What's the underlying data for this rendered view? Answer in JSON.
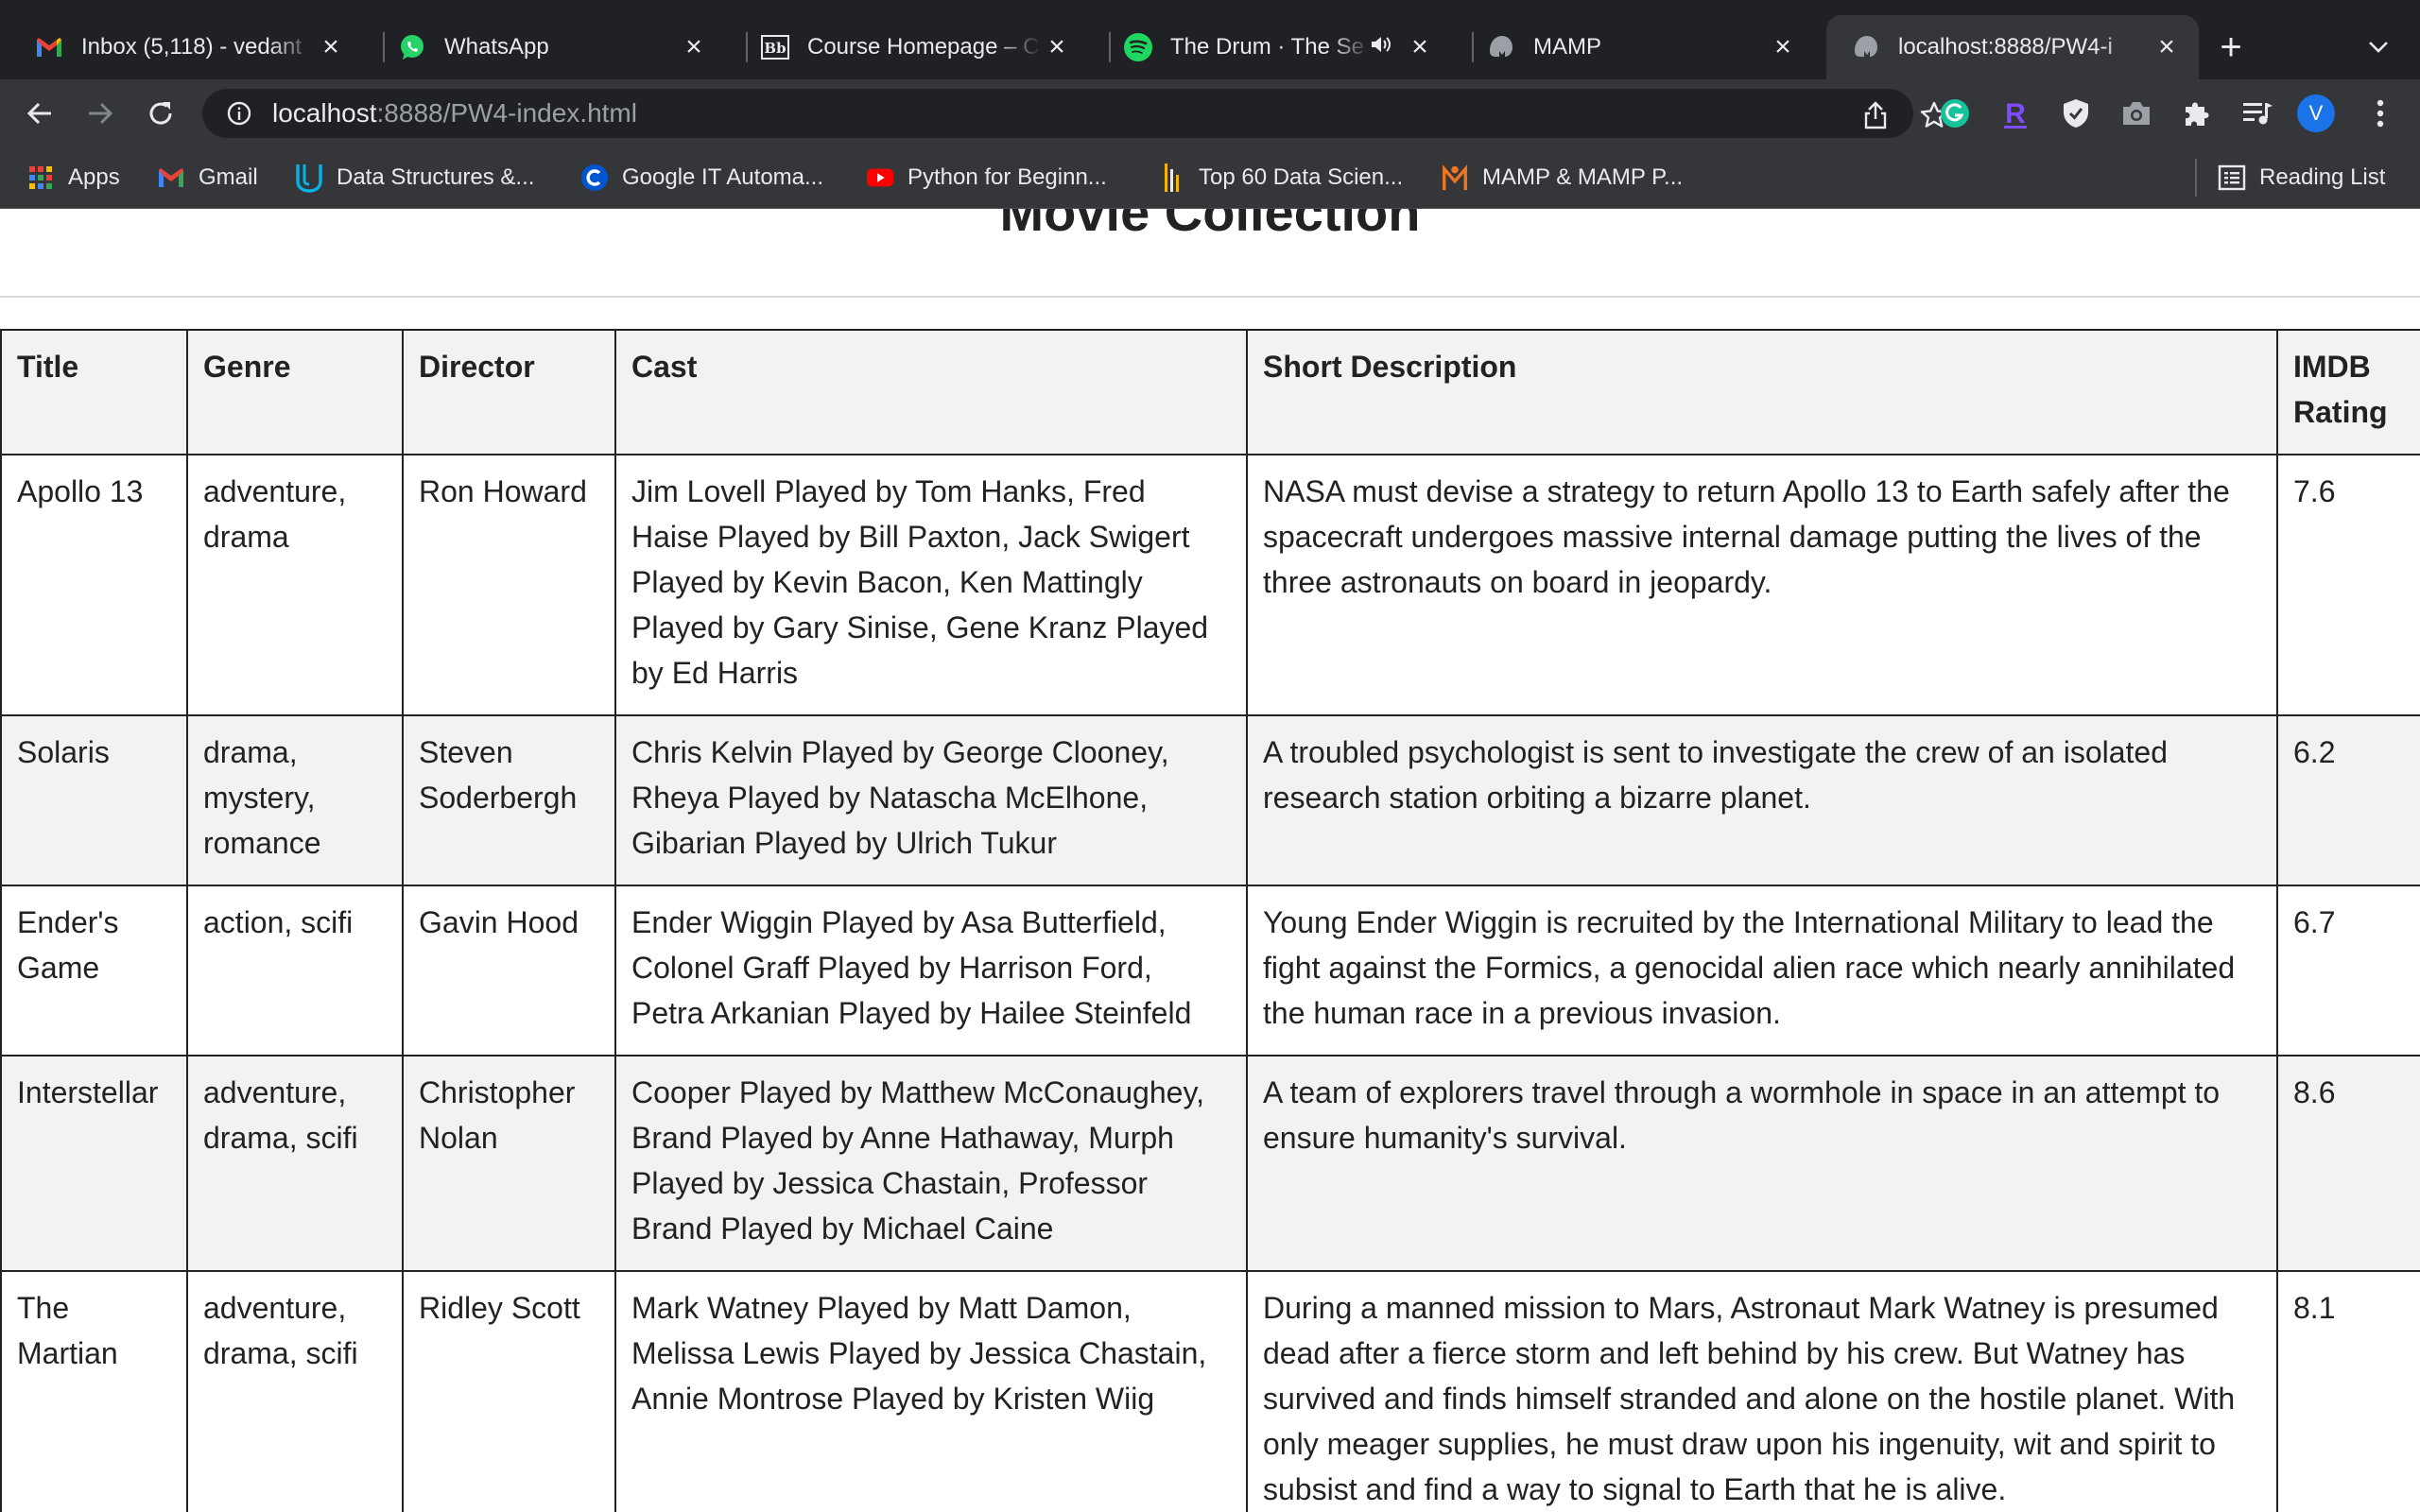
{
  "browser": {
    "tabs": [
      {
        "title": "Inbox (5,118) - vedant",
        "icon": "gmail-icon"
      },
      {
        "title": "WhatsApp",
        "icon": "whatsapp-icon"
      },
      {
        "title": "Course Homepage – C",
        "icon": "blackboard-icon"
      },
      {
        "title": "The Drum · The Se",
        "icon": "spotify-icon"
      },
      {
        "title": "MAMP",
        "icon": "mamp-icon"
      },
      {
        "title": "localhost:8888/PW4-i",
        "icon": "mamp-icon"
      }
    ],
    "active_tab": 5,
    "url_host": "localhost",
    "url_rest": ":8888/PW4-index.html",
    "profile_initial": "V",
    "bookmarks": [
      {
        "label": "Apps",
        "icon": "apps-grid-icon"
      },
      {
        "label": "Gmail",
        "icon": "gmail-icon"
      },
      {
        "label": "Data Structures &...",
        "icon": "udacity-icon"
      },
      {
        "label": "Google IT Automa...",
        "icon": "coursera-icon"
      },
      {
        "label": "Python for Beginn...",
        "icon": "youtube-icon"
      },
      {
        "label": "Top 60 Data Scien...",
        "icon": "bookmark-site-icon"
      },
      {
        "label": "MAMP & MAMP P...",
        "icon": "mamp-icon"
      }
    ],
    "reading_list_label": "Reading List",
    "colors": {
      "chrome_dark": "#202124",
      "chrome_toolbar": "#35363a",
      "accent_blue": "#1a73e8"
    }
  },
  "page": {
    "title": "Movie Collection",
    "columns": [
      "Title",
      "Genre",
      "Director",
      "Cast",
      "Short Description",
      "IMDB Rating"
    ],
    "rows": [
      {
        "title": "Apollo 13",
        "genre": "adventure, drama",
        "director": "Ron Howard",
        "cast": "Jim Lovell Played by Tom Hanks, Fred Haise Played by Bill Paxton, Jack Swigert Played by Kevin Bacon, Ken Mattingly Played by Gary Sinise, Gene Kranz Played by Ed Harris",
        "description": "NASA must devise a strategy to return Apollo 13 to Earth safely after the spacecraft undergoes massive internal damage putting the lives of the three astronauts on board in jeopardy.",
        "rating": "7.6"
      },
      {
        "title": "Solaris",
        "genre": "drama, mystery, romance",
        "director": "Steven Soderbergh",
        "cast": "Chris Kelvin Played by George Clooney, Rheya Played by Natascha McElhone, Gibarian Played by Ulrich Tukur",
        "description": "A troubled psychologist is sent to investigate the crew of an isolated research station orbiting a bizarre planet.",
        "rating": "6.2"
      },
      {
        "title": "Ender's Game",
        "genre": "action, scifi",
        "director": "Gavin Hood",
        "cast": "Ender Wiggin Played by Asa Butterfield, Colonel Graff Played by Harrison Ford, Petra Arkanian Played by Hailee Steinfeld",
        "description": "Young Ender Wiggin is recruited by the International Military to lead the fight against the Formics, a genocidal alien race which nearly annihilated the human race in a previous invasion.",
        "rating": "6.7"
      },
      {
        "title": "Interstellar",
        "genre": "adventure, drama, scifi",
        "director": "Christopher Nolan",
        "cast": "Cooper Played by Matthew McConaughey, Brand Played by Anne Hathaway, Murph Played by Jessica Chastain, Professor Brand Played by Michael Caine",
        "description": "A team of explorers travel through a wormhole in space in an attempt to ensure humanity's survival.",
        "rating": "8.6"
      },
      {
        "title": "The Martian",
        "genre": "adventure, drama, scifi",
        "director": "Ridley Scott",
        "cast": "Mark Watney Played by Matt Damon, Melissa Lewis Played by Jessica Chastain, Annie Montrose Played by Kristen Wiig",
        "description": "During a manned mission to Mars, Astronaut Mark Watney is presumed dead after a fierce storm and left behind by his crew. But Watney has survived and finds himself stranded and alone on the hostile planet. With only meager supplies, he must draw upon his ingenuity, wit and spirit to subsist and find a way to signal to Earth that he is alive.",
        "rating": "8.1"
      }
    ]
  }
}
